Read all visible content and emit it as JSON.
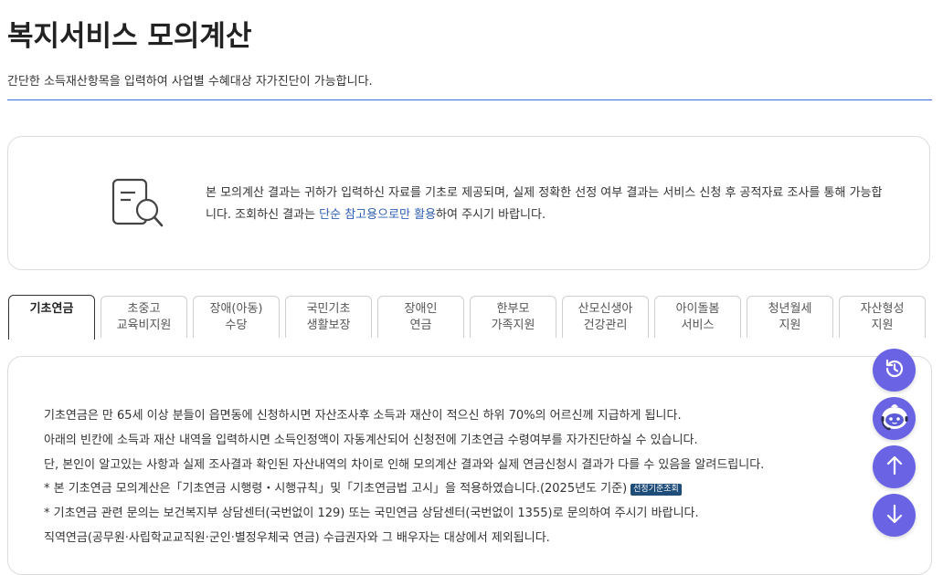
{
  "page": {
    "title": "복지서비스 모의계산",
    "subtitle": "간단한 소득재산항목을 입력하여 사업별 수혜대상 자가진단이 가능합니다."
  },
  "notice": {
    "icon": "document-search-icon",
    "text_before": "본 모의계산 결과는 귀하가 입력하신 자료를 기초로 제공되며, 실제 정확한 선정 여부 결과는 서비스 신청 후 공적자료 조사를 통해 가능합니다. 조회하신 결과는 ",
    "highlight": "단순 참고용으로만 활용",
    "text_after": "하여 주시기 바랍니다."
  },
  "tabs": [
    {
      "line1": "기초연금",
      "line2": "",
      "active": true
    },
    {
      "line1": "초중고",
      "line2": "교육비지원",
      "active": false
    },
    {
      "line1": "장애(아동)",
      "line2": "수당",
      "active": false
    },
    {
      "line1": "국민기초",
      "line2": "생활보장",
      "active": false
    },
    {
      "line1": "장애인",
      "line2": "연금",
      "active": false
    },
    {
      "line1": "한부모",
      "line2": "가족지원",
      "active": false
    },
    {
      "line1": "산모신생아",
      "line2": "건강관리",
      "active": false
    },
    {
      "line1": "아이돌봄",
      "line2": "서비스",
      "active": false
    },
    {
      "line1": "청년월세",
      "line2": "지원",
      "active": false
    },
    {
      "line1": "자산형성",
      "line2": "지원",
      "active": false
    }
  ],
  "content": {
    "line1": "기초연금은 만 65세 이상 분들이 읍면동에 신청하시면 자산조사후 소득과 재산이 적으신 하위 70%의 어르신께 지급하게 됩니다.",
    "line2": "아래의 빈칸에 소득과 재산 내역을 입력하시면 소득인정액이 자동계산되어 신청전에 기초연금 수령여부를 자가진단하실 수 있습니다.",
    "line3": "단, 본인이 알고있는 사항과 실제 조사결과 확인된 자산내역의 차이로 인해 모의계산 결과와 실제 연금신청시 결과가 다를 수 있음을 알려드립니다.",
    "line4": "* 본 기초연금 모의계산은「기초연금 시행령・시행규칙」및「기초연금법 고시」을 적용하였습니다.(2025년도 기준)",
    "badge": "선정기준조회",
    "line5": "* 기초연금 관련 문의는 보건복지부 상담센터(국번없이 129) 또는 국민연금 상담센터(국번없이 1355)로 문의하여 주시기 바랍니다.",
    "line6": "직역연금(공무원·사립학교교직원·군인·별정우체국 연금) 수급권자와 그 배우자는 대상에서 제외됩니다."
  },
  "fabs": {
    "history": "history-icon",
    "chatbot": "chatbot-icon",
    "up": "arrow-up-icon",
    "down": "arrow-down-icon"
  },
  "colors": {
    "accent": "#3b6fd8",
    "highlight": "#2f5fb3",
    "fab": "#6a64e5",
    "badge": "#1e4d7a"
  }
}
